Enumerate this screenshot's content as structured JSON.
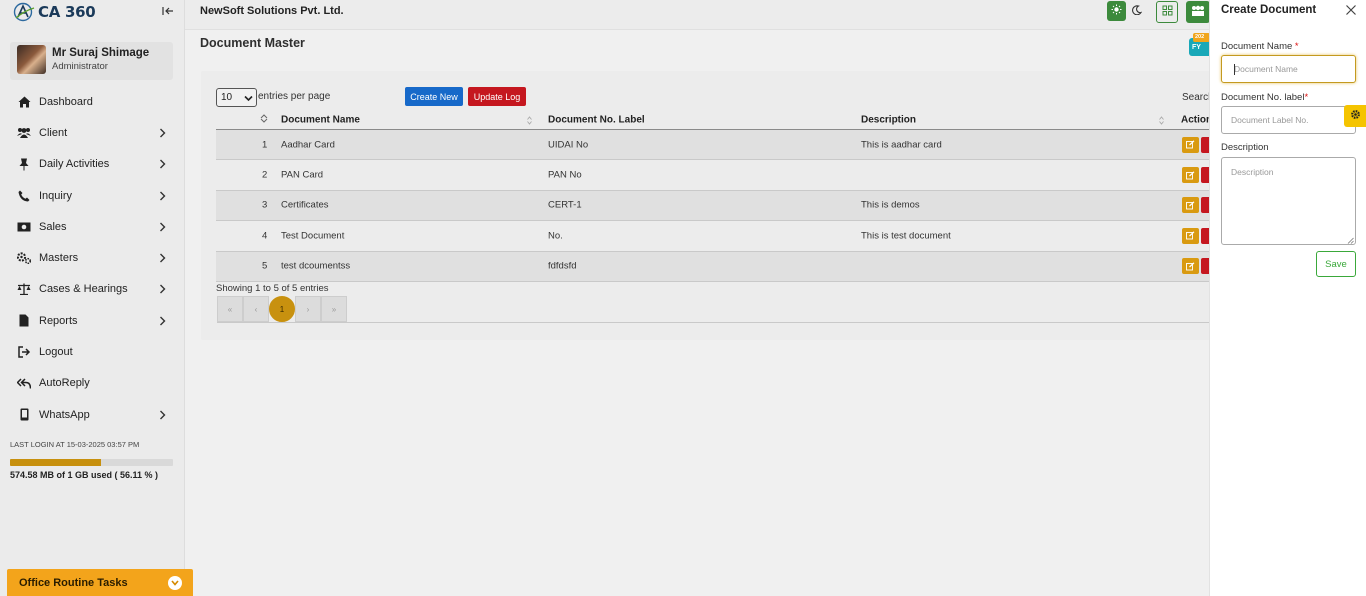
{
  "app": {
    "logo_text": "CA 360",
    "logo_sup": "°"
  },
  "header": {
    "company": "NewSoft Solutions Pvt. Ltd."
  },
  "profile": {
    "name": "Mr Suraj Shimage",
    "role": "Administrator"
  },
  "sidebar": {
    "items": [
      {
        "label": "Dashboard",
        "icon": "home-icon",
        "has_submenu": false
      },
      {
        "label": "Client",
        "icon": "users-icon",
        "has_submenu": true
      },
      {
        "label": "Daily Activities",
        "icon": "pin-icon",
        "has_submenu": true
      },
      {
        "label": "Inquiry",
        "icon": "phone-icon",
        "has_submenu": true
      },
      {
        "label": "Sales",
        "icon": "money-icon",
        "has_submenu": true
      },
      {
        "label": "Masters",
        "icon": "cogs-icon",
        "has_submenu": true
      },
      {
        "label": "Cases & Hearings",
        "icon": "scale-icon",
        "has_submenu": true
      },
      {
        "label": "Reports",
        "icon": "file-icon",
        "has_submenu": true
      },
      {
        "label": "Logout",
        "icon": "logout-icon",
        "has_submenu": false
      },
      {
        "label": "AutoReply",
        "icon": "reply-all-icon",
        "has_submenu": false
      },
      {
        "label": "WhatsApp",
        "icon": "mobile-icon",
        "has_submenu": true
      }
    ],
    "last_login": "LAST LOGIN AT 15-03-2025 03:57 PM",
    "storage_text": "574.58 MB of 1 GB used ( 56.11 % )",
    "storage_fraction": 0.5611,
    "routine_label": "Office Routine Tasks"
  },
  "main": {
    "title": "Document Master",
    "fy_badge": "FY",
    "fy_top": "202",
    "entries_value": "10",
    "entries_label": "entries per page",
    "create_label": "Create New",
    "update_log_label": "Update Log",
    "search_label": "Search",
    "columns": [
      "Document Name",
      "Document No. Label",
      "Description",
      "Action"
    ],
    "rows": [
      {
        "no": "1",
        "name": "Aadhar Card",
        "label": "UIDAI No",
        "desc": "This is aadhar card"
      },
      {
        "no": "2",
        "name": "PAN Card",
        "label": "PAN No",
        "desc": ""
      },
      {
        "no": "3",
        "name": "Certificates",
        "label": "CERT-1",
        "desc": "This is demos"
      },
      {
        "no": "4",
        "name": "Test Document",
        "label": "No.",
        "desc": "This is test document"
      },
      {
        "no": "5",
        "name": "test dcoumentss",
        "label": "fdfdsfd",
        "desc": ""
      }
    ],
    "showing": "Showing 1 to 5 of 5 entries",
    "pager": [
      "«",
      "‹",
      "1",
      "›",
      "»"
    ],
    "current_page": "1"
  },
  "panel": {
    "title": "Create Document",
    "doc_name_label": "Document Name",
    "doc_name_placeholder": "Document Name",
    "doc_no_label": "Document No. label",
    "doc_no_placeholder": "Document Label No.",
    "desc_label": "Description",
    "desc_placeholder": "Description",
    "required_mark": "*",
    "save_label": "Save"
  },
  "colors": {
    "accent": "#c8910f",
    "primary": "#1769c9",
    "danger": "#c5171f",
    "success": "#3aa83a",
    "warning": "#f3a41b"
  }
}
